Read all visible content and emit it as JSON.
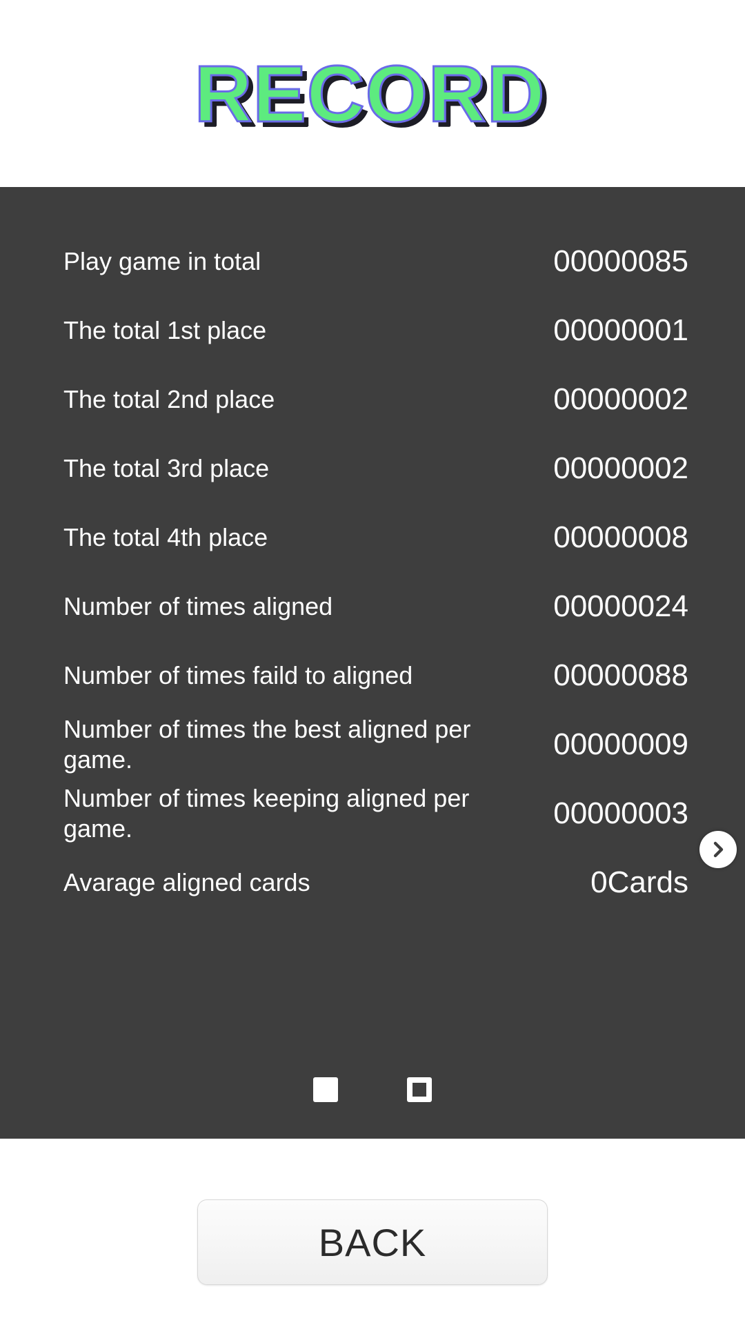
{
  "header": {
    "title": "RECORD",
    "title_color": "#5DEB7F",
    "title_outline_color": "#6A6AE8",
    "title_shadow_color": "#1D1D26"
  },
  "panel": {
    "background_color": "#3E3E3E",
    "text_color": "#FFFFFF",
    "stats": [
      {
        "label": "Play game in total",
        "value": "00000085"
      },
      {
        "label": "The total 1st place",
        "value": "00000001"
      },
      {
        "label": "The total 2nd place",
        "value": "00000002"
      },
      {
        "label": "The total 3rd place",
        "value": "00000002"
      },
      {
        "label": "The total 4th place",
        "value": "00000008"
      },
      {
        "label": "Number of times aligned",
        "value": "00000024"
      },
      {
        "label": "Number of times faild to aligned",
        "value": "00000088"
      },
      {
        "label": "Number of times the best aligned per game.",
        "value": "00000009"
      },
      {
        "label": "Number of times keeping aligned per game.",
        "value": "00000003"
      },
      {
        "label": "Avarage aligned cards",
        "value": "0Cards"
      }
    ]
  },
  "next_page": {
    "icon": "chevron-right-icon",
    "icon_glyph": "›",
    "circle_color": "#FFFFFF",
    "glyph_color": "#3E3E3E"
  },
  "pagination": {
    "total_pages": 2,
    "current_page": 1,
    "dots": [
      {
        "state": "active",
        "shape": "filled-square"
      },
      {
        "state": "inactive",
        "shape": "hollow-square"
      }
    ]
  },
  "footer": {
    "back_label": "BACK"
  }
}
